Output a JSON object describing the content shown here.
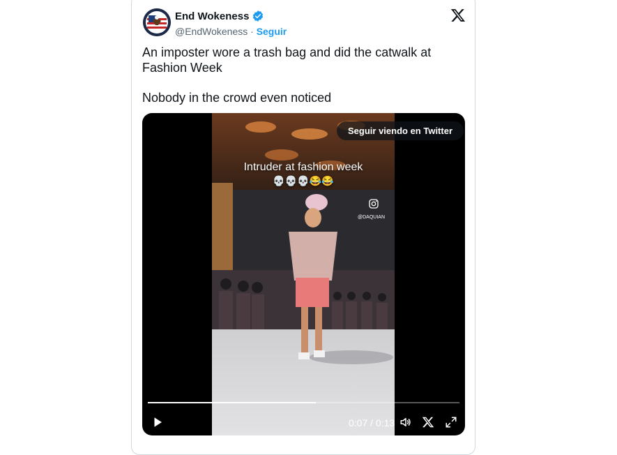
{
  "author": {
    "name": "End Wokeness",
    "handle": "@EndWokeness",
    "separator": "·",
    "follow_label": "Seguir",
    "avatar": "eagle-flag-avatar",
    "verified": true
  },
  "tweet": {
    "line1": "An imposter wore a trash bag and did the catwalk at Fashion Week",
    "line2": "Nobody in the crowd even noticed"
  },
  "video": {
    "keep_watching_label": "Seguir viendo en Twitter",
    "caption": "Intruder at fashion week",
    "emojis": "💀💀💀😂😂",
    "watermark": "@DAQUIAN",
    "time": "0:07 / 0:13",
    "progress": 0.54
  },
  "icons": {
    "verified": "verified-badge-icon",
    "x_logo": "x-logo-icon",
    "play": "play-icon",
    "volume": "volume-icon",
    "x_small": "x-small-icon",
    "fullscreen": "fullscreen-icon",
    "instagram": "instagram-icon"
  },
  "colors": {
    "accent": "#1d9bf0",
    "text": "#0f1419",
    "secondary": "#536471"
  }
}
